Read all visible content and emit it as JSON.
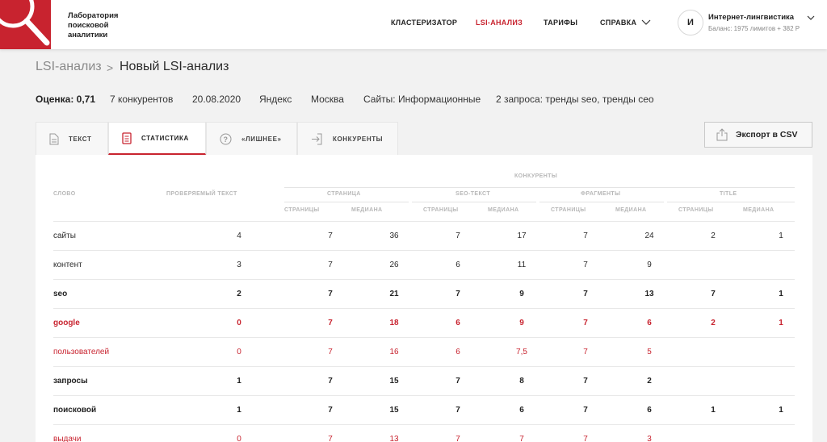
{
  "header": {
    "brand_line1": "Лаборатория",
    "brand_line2": "поисковой",
    "brand_line3": "аналитики",
    "nav": [
      {
        "label": "Кластеризатор",
        "active": false
      },
      {
        "label": "LSI-анализ",
        "active": true
      },
      {
        "label": "Тарифы",
        "active": false
      },
      {
        "label": "Справка",
        "active": false
      }
    ],
    "user": {
      "initial": "И",
      "name": "Интернет-лингвистика",
      "balance": "Баланс: 1975 лимитов + 382 Р"
    }
  },
  "breadcrumb": {
    "parent": "LSI-анализ",
    "separator": ">",
    "current": "Новый LSI-анализ"
  },
  "meta": {
    "score": "Оценка: 0,71",
    "competitors": "7 конкурентов",
    "date": "20.08.2020",
    "engine": "Яндекс",
    "region": "Москва",
    "sites": "Сайты: Информационные",
    "queries": "2 запроса: тренды seo, тренды ceo"
  },
  "tabs": [
    {
      "label": "Текст",
      "icon": "document-icon"
    },
    {
      "label": "Статистика",
      "icon": "list-icon",
      "active": true
    },
    {
      "label": "«Лишнее»",
      "icon": "question-icon"
    },
    {
      "label": "Конкуренты",
      "icon": "login-icon"
    }
  ],
  "export_label": "Экспорт в CSV",
  "table": {
    "headers": {
      "word": "Слово",
      "checked_text": "Проверяемый текст",
      "competitors": "Конкуренты",
      "groups": [
        "Страница",
        "SEO-текст",
        "Фрагменты",
        "Title"
      ],
      "sub": [
        "Страницы",
        "Медиана",
        "Страницы",
        "Медиана",
        "Страницы",
        "Медиана",
        "Страницы",
        "Медиана"
      ]
    },
    "rows": [
      {
        "word": "сайты",
        "style": "normal",
        "checked": "4",
        "values": [
          "7",
          "36",
          "7",
          "17",
          "7",
          "24",
          "2",
          "1"
        ],
        "bold_idx": []
      },
      {
        "word": "контент",
        "style": "normal",
        "checked": "3",
        "values": [
          "7",
          "26",
          "6",
          "11",
          "7",
          "9",
          "",
          ""
        ],
        "bold_idx": []
      },
      {
        "word": "seo",
        "style": "bold",
        "checked": "2",
        "values": [
          "7",
          "21",
          "7",
          "9",
          "7",
          "13",
          "7",
          "1"
        ],
        "bold_idx": [
          3
        ]
      },
      {
        "word": "google",
        "style": "red-bold",
        "checked": "0",
        "values": [
          "7",
          "18",
          "6",
          "9",
          "7",
          "6",
          "2",
          "1"
        ],
        "bold_idx": [
          3
        ]
      },
      {
        "word": "пользователей",
        "style": "red",
        "checked": "0",
        "values": [
          "7",
          "16",
          "6",
          "7,5",
          "7",
          "5",
          "",
          ""
        ],
        "bold_idx": []
      },
      {
        "word": "запросы",
        "style": "bold",
        "checked": "1",
        "values": [
          "7",
          "15",
          "7",
          "8",
          "7",
          "2",
          "",
          ""
        ],
        "bold_idx": [
          3
        ]
      },
      {
        "word": "поисковой",
        "style": "bold",
        "checked": "1",
        "values": [
          "7",
          "15",
          "7",
          "6",
          "7",
          "6",
          "1",
          "1"
        ],
        "bold_idx": [
          3
        ]
      },
      {
        "word": "выдачи",
        "style": "red",
        "checked": "0",
        "values": [
          "7",
          "13",
          "7",
          "7",
          "7",
          "3",
          "",
          ""
        ],
        "bold_idx": []
      }
    ]
  },
  "colors": {
    "accent": "#c8232f",
    "background": "#f2f2f2"
  }
}
